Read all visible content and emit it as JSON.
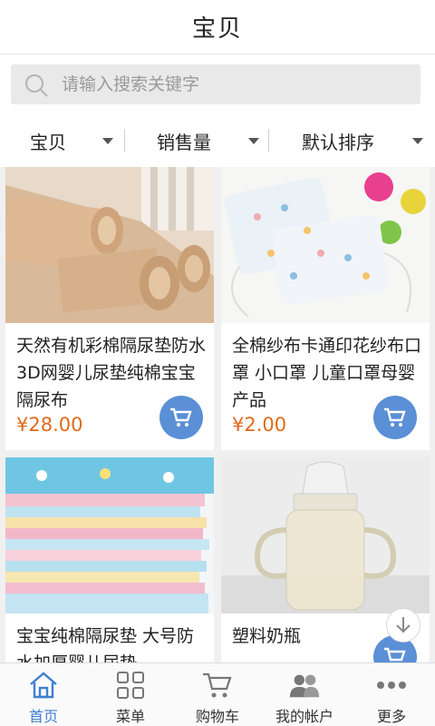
{
  "header": {
    "title": "宝贝"
  },
  "search": {
    "placeholder": "请输入搜索关键字"
  },
  "filters": [
    {
      "label": "宝贝"
    },
    {
      "label": "销售量"
    },
    {
      "label": "默认排序"
    }
  ],
  "products": [
    {
      "name": "天然有机彩棉隔尿垫防水3D网婴儿尿垫纯棉宝宝隔尿布",
      "price": "¥28.00",
      "image": "rolled-cotton-pads"
    },
    {
      "name": "全棉纱布卡通印花纱布口罩 小口罩 儿童口罩母婴产品",
      "price": "¥2.00",
      "image": "gauze-masks"
    },
    {
      "name": "宝宝纯棉隔尿垫 大号防水加厚婴儿尿垫",
      "price": "",
      "image": "stacked-pads"
    },
    {
      "name": "塑料奶瓶",
      "price": "¥??.??",
      "image": "baby-bottle"
    }
  ],
  "tabbar": [
    {
      "label": "首页",
      "icon": "home-icon",
      "active": true
    },
    {
      "label": "菜单",
      "icon": "grid-icon",
      "active": false
    },
    {
      "label": "购物车",
      "icon": "cart-icon",
      "active": false
    },
    {
      "label": "我的帐户",
      "icon": "users-icon",
      "active": false
    },
    {
      "label": "更多",
      "icon": "more-icon",
      "active": false
    }
  ],
  "colors": {
    "accent": "#3f7fd0",
    "cart_button": "#5b8fd6",
    "price": "#e06a1b"
  }
}
